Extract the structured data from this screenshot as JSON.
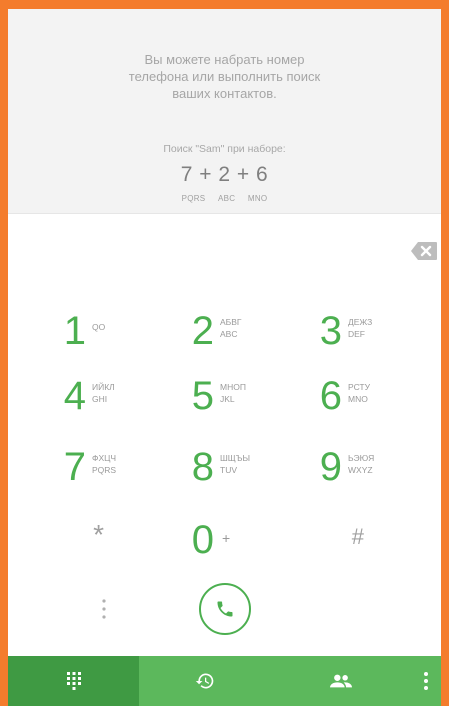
{
  "hint": {
    "line1": "Вы можете набрать номер",
    "line2": "телефона или выполнить поиск",
    "line3": "ваших контактов.",
    "search_label": "Поиск \"Sam\" при наборе:",
    "formula": "7 + 2 + 6",
    "formula_letters": [
      "PQRS",
      "ABC",
      "MNO"
    ]
  },
  "keypad": {
    "keys": [
      {
        "digit": "1",
        "letters_top": "QO",
        "letters_bottom": ""
      },
      {
        "digit": "2",
        "letters_top": "АБВГ",
        "letters_bottom": "ABC"
      },
      {
        "digit": "3",
        "letters_top": "ДЕЖЗ",
        "letters_bottom": "DEF"
      },
      {
        "digit": "4",
        "letters_top": "ИЙКЛ",
        "letters_bottom": "GHI"
      },
      {
        "digit": "5",
        "letters_top": "МНОП",
        "letters_bottom": "JKL"
      },
      {
        "digit": "6",
        "letters_top": "РСТУ",
        "letters_bottom": "MNO"
      },
      {
        "digit": "7",
        "letters_top": "ФХЦЧ",
        "letters_bottom": "PQRS"
      },
      {
        "digit": "8",
        "letters_top": "ШЩЪЫ",
        "letters_bottom": "TUV"
      },
      {
        "digit": "9",
        "letters_top": "ЬЭЮЯ",
        "letters_bottom": "WXYZ"
      }
    ],
    "star": "*",
    "zero": "0",
    "zero_sub": "+",
    "hash": "#"
  },
  "icons": {
    "backspace": "backspace-icon",
    "call": "phone-icon",
    "more": "more-vertical-icon",
    "tabs": [
      "dialpad-icon",
      "history-icon",
      "contacts-icon",
      "more-vertical-icon"
    ]
  },
  "colors": {
    "accent": "#4caf50",
    "tab_bar": "#5cb85c",
    "tab_active": "#3f9a43",
    "frame": "#f47c2c"
  }
}
